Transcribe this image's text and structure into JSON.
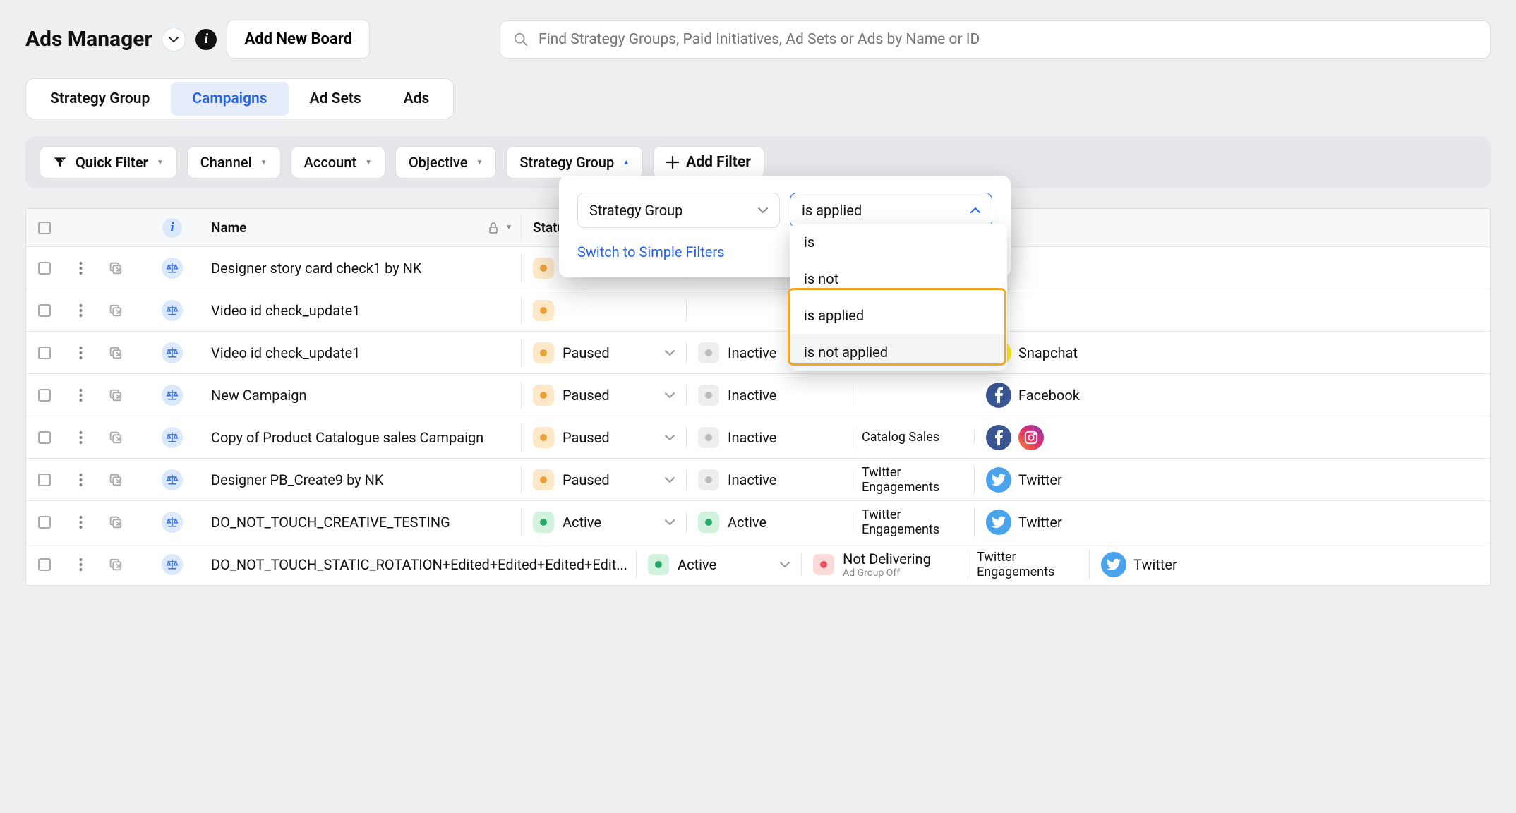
{
  "header": {
    "title": "Ads Manager",
    "add_board": "Add New Board",
    "search_placeholder": "Find Strategy Groups, Paid Initiatives, Ad Sets or Ads by Name or ID"
  },
  "tabs": [
    {
      "label": "Strategy Group",
      "active": false
    },
    {
      "label": "Campaigns",
      "active": true
    },
    {
      "label": "Ad Sets",
      "active": false
    },
    {
      "label": "Ads",
      "active": false
    }
  ],
  "filters": {
    "quick": "Quick Filter",
    "channel": "Channel",
    "account": "Account",
    "objective": "Objective",
    "strategy_group": "Strategy Group",
    "add": "Add Filter"
  },
  "popover": {
    "field": "Strategy Group",
    "operator": "is applied",
    "switch": "Switch to Simple Filters",
    "options": [
      "is",
      "is not",
      "is applied",
      "is not applied"
    ]
  },
  "columns": {
    "name": "Name",
    "status": "Statu"
  },
  "rows": [
    {
      "name": "Designer story card check1 by NK",
      "status": "",
      "status_color": "orange",
      "eff": "",
      "eff_color": "",
      "objective": "",
      "channel": "",
      "icons": []
    },
    {
      "name": "Video id check_update1",
      "status": "",
      "status_color": "orange",
      "eff": "",
      "eff_color": "",
      "objective": "",
      "channel": "",
      "icons": []
    },
    {
      "name": "Video id check_update1",
      "status": "Paused",
      "status_color": "orange",
      "eff": "Inactive",
      "eff_color": "grey",
      "objective": "",
      "channel": "Snapchat",
      "icons": [
        "snap"
      ]
    },
    {
      "name": "New Campaign",
      "status": "Paused",
      "status_color": "orange",
      "eff": "Inactive",
      "eff_color": "grey",
      "objective": "",
      "channel": "Facebook",
      "icons": [
        "fb"
      ]
    },
    {
      "name": "Copy of Product Catalogue sales Campaign",
      "status": "Paused",
      "status_color": "orange",
      "eff": "Inactive",
      "eff_color": "grey",
      "objective": "Catalog Sales",
      "channel": "",
      "icons": [
        "fb",
        "ig"
      ]
    },
    {
      "name": "Designer PB_Create9 by NK",
      "status": "Paused",
      "status_color": "orange",
      "eff": "Inactive",
      "eff_color": "grey",
      "objective": "Twitter Engagements",
      "channel": "Twitter",
      "icons": [
        "tw"
      ]
    },
    {
      "name": "DO_NOT_TOUCH_CREATIVE_TESTING",
      "status": "Active",
      "status_color": "green",
      "eff": "Active",
      "eff_color": "green",
      "objective": "Twitter Engagements",
      "channel": "Twitter",
      "icons": [
        "tw"
      ]
    },
    {
      "name": "DO_NOT_TOUCH_STATIC_ROTATION+Edited+Edited+Edited+Edit...",
      "status": "Active",
      "status_color": "green",
      "eff": "Not Delivering",
      "eff_sub": "Ad Group Off",
      "eff_color": "red",
      "objective": "Twitter Engagements",
      "channel": "Twitter",
      "icons": [
        "tw"
      ]
    }
  ]
}
